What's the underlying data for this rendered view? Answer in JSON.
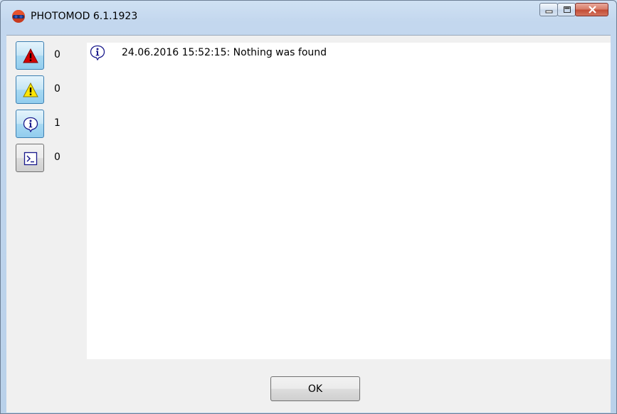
{
  "window": {
    "title": "PHOTOMOD 6.1.1923",
    "app_icon": "photomod-logo-icon",
    "caption_buttons": [
      "minimize-icon",
      "maximize-icon",
      "close-icon"
    ]
  },
  "filters": [
    {
      "name": "errors",
      "icon": "error-triangle-icon",
      "count": "0",
      "pressed": true,
      "color": "#d40000"
    },
    {
      "name": "warnings",
      "icon": "warning-triangle-icon",
      "count": "0",
      "pressed": true,
      "color": "#ffe600"
    },
    {
      "name": "info",
      "icon": "info-icon",
      "count": "1",
      "pressed": true,
      "color": "#1a1a8c"
    },
    {
      "name": "console",
      "icon": "console-icon",
      "count": "0",
      "pressed": false,
      "color": "#1a1a8c"
    }
  ],
  "log": {
    "entries": [
      {
        "icon": "info-icon",
        "text": "24.06.2016 15:52:15: Nothing was found"
      }
    ]
  },
  "buttons": {
    "ok_label": "OK"
  }
}
